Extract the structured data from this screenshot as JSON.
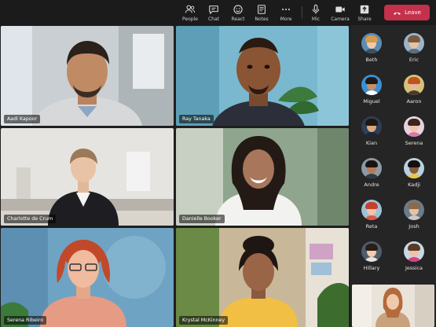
{
  "toolbar": {
    "items": [
      {
        "label": "People",
        "icon": "people-icon"
      },
      {
        "label": "Chat",
        "icon": "chat-icon"
      },
      {
        "label": "React",
        "icon": "react-icon"
      },
      {
        "label": "Notes",
        "icon": "notes-icon"
      },
      {
        "label": "More",
        "icon": "more-icon"
      },
      {
        "label": "Mic",
        "icon": "mic-icon"
      },
      {
        "label": "Camera",
        "icon": "camera-icon"
      },
      {
        "label": "Share",
        "icon": "share-icon"
      }
    ],
    "leave_label": "Leave",
    "leave_color": "#c4314b"
  },
  "tiles": [
    {
      "name": "Aadi Kapoor"
    },
    {
      "name": "Ray Tanaka"
    },
    {
      "name": "Charlotte de Crum"
    },
    {
      "name": "Danielle Booker"
    },
    {
      "name": "Serena Ribeiro"
    },
    {
      "name": "Krystal McKinney"
    }
  ],
  "roster": [
    {
      "name": "Beth"
    },
    {
      "name": "Eric"
    },
    {
      "name": "Miguel"
    },
    {
      "name": "Aaron"
    },
    {
      "name": "Kian"
    },
    {
      "name": "Serena"
    },
    {
      "name": "Andre"
    },
    {
      "name": "Kadji"
    },
    {
      "name": "Reta"
    },
    {
      "name": "Josh"
    },
    {
      "name": "Hillary"
    },
    {
      "name": "Jessica"
    }
  ]
}
